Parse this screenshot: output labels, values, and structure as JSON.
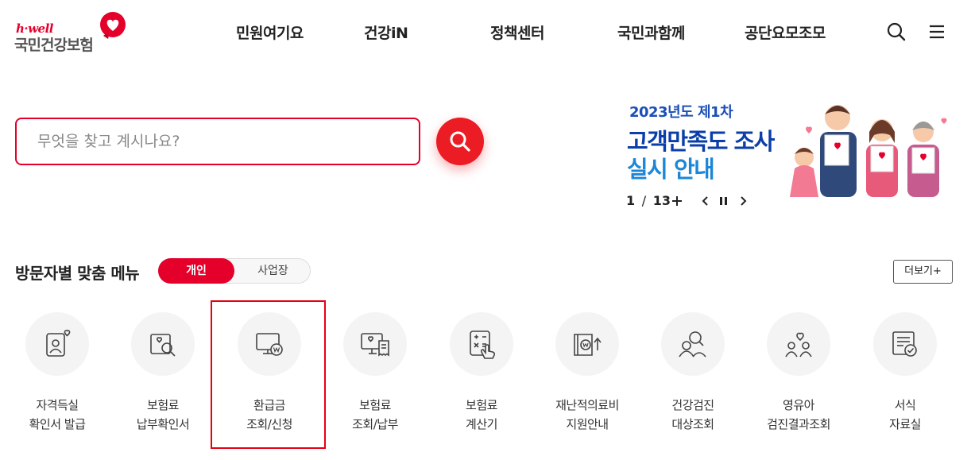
{
  "brand": {
    "tagline": "h·well",
    "org_name": "국민건강보험",
    "accent": "#e4002b"
  },
  "nav": {
    "items": [
      {
        "label": "민원여기요"
      },
      {
        "label": "건강iN"
      },
      {
        "label": "정책센터"
      },
      {
        "label": "국민과함께"
      },
      {
        "label": "공단요모조모"
      }
    ],
    "search_icon": "search-icon",
    "menu_icon": "hamburger-menu-icon"
  },
  "search": {
    "placeholder": "무엇을 찾고 계시나요?",
    "value": ""
  },
  "banner": {
    "line1": "2023년도 제1차",
    "line2": "고객만족도 조사",
    "line3": "실시 안내",
    "pager": {
      "current": "1",
      "total": "13",
      "separator": "/"
    }
  },
  "section": {
    "title": "방문자별 맞춤 메뉴",
    "tabs": [
      {
        "label": "개인",
        "active": true
      },
      {
        "label": "사업장",
        "active": false
      }
    ],
    "more_label": "더보기+"
  },
  "menu": [
    {
      "line1": "자격득실",
      "line2": "확인서 발급",
      "icon": "id-card-heart-icon"
    },
    {
      "line1": "보험료",
      "line2": "납부확인서",
      "icon": "document-search-icon"
    },
    {
      "line1": "환급금",
      "line2": "조회/신청",
      "icon": "monitor-won-icon",
      "highlighted": true
    },
    {
      "line1": "보험료",
      "line2": "조회/납부",
      "icon": "monitor-receipt-icon"
    },
    {
      "line1": "보험료",
      "line2": "계산기",
      "icon": "calculator-hand-icon"
    },
    {
      "line1": "재난적의료비",
      "line2": "지원안내",
      "icon": "wallet-won-up-icon"
    },
    {
      "line1": "건강검진",
      "line2": "대상조회",
      "icon": "people-search-icon"
    },
    {
      "line1": "영유아",
      "line2": "검진결과조회",
      "icon": "family-heart-icon"
    },
    {
      "line1": "서식",
      "line2": "자료실",
      "icon": "form-check-icon"
    }
  ]
}
